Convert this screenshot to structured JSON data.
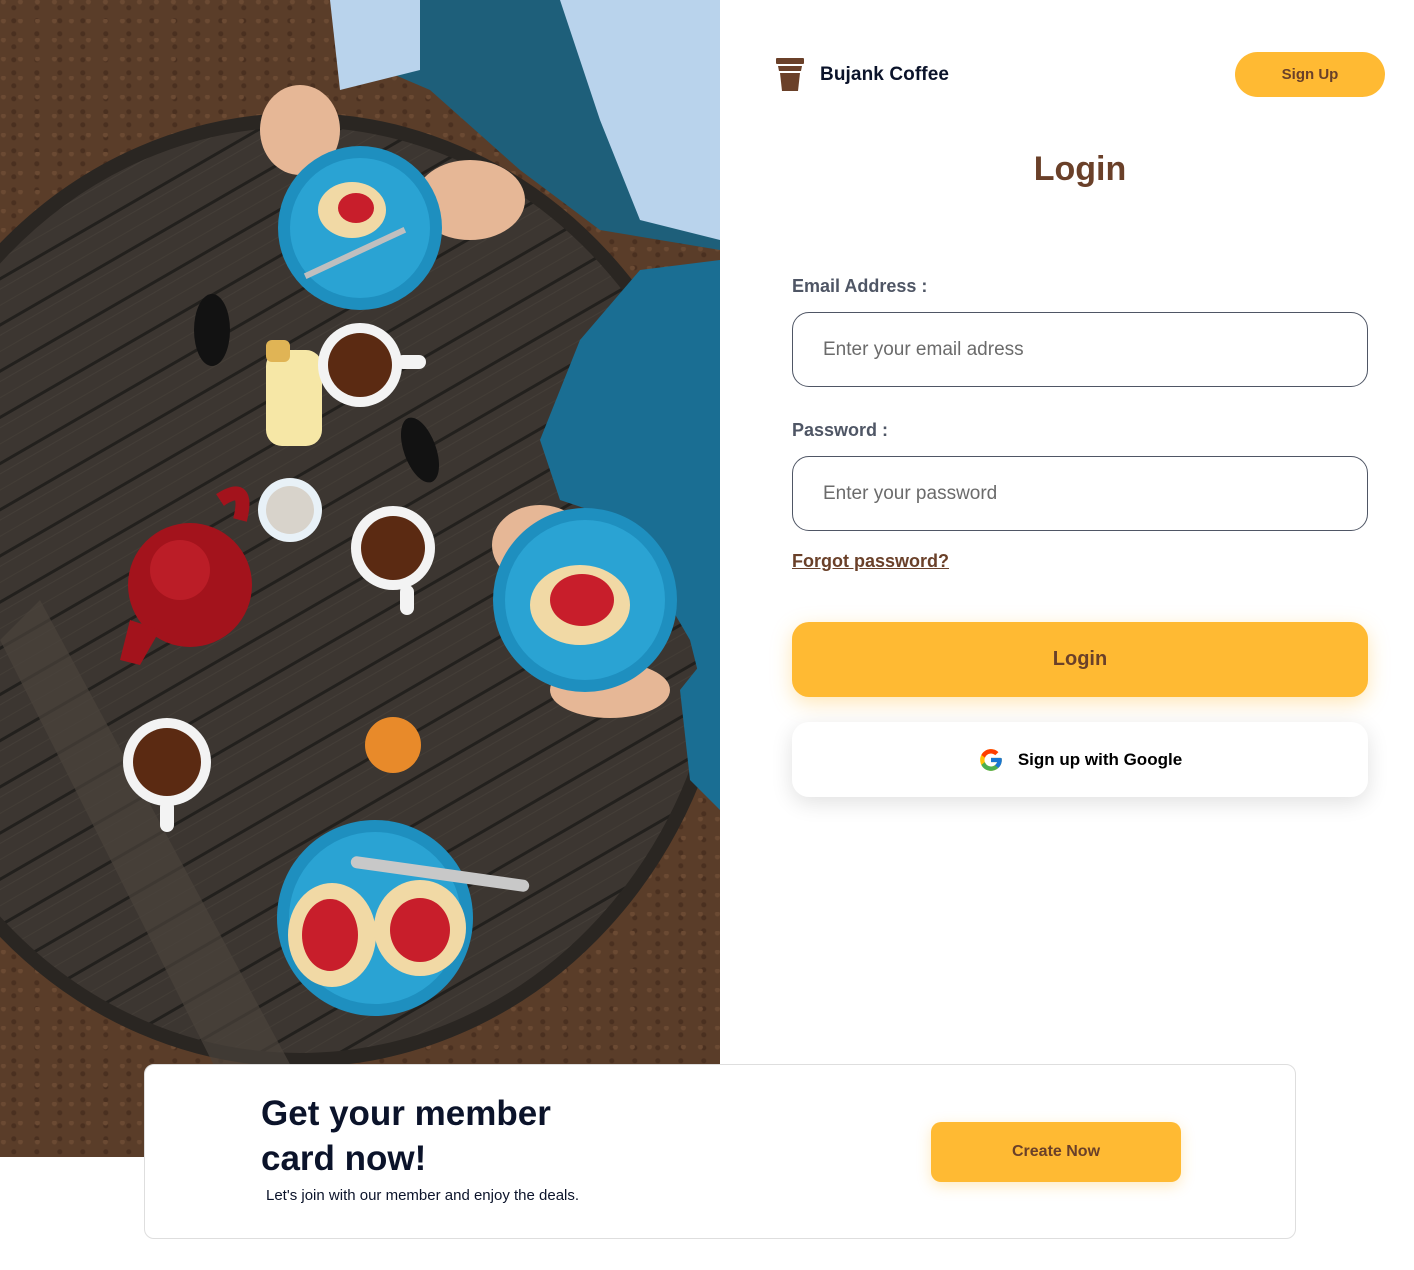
{
  "header": {
    "brand_name": "Bujank Coffee",
    "brand_icon": "coffee-cup-icon",
    "signup_label": "Sign Up"
  },
  "login_form": {
    "title": "Login",
    "email_label": "Email Address :",
    "email_placeholder": "Enter your email adress",
    "email_value": "",
    "password_label": "Password :",
    "password_placeholder": "Enter your password",
    "password_value": "",
    "forgot_label": "Forgot password?",
    "login_label": "Login",
    "google_label": "Sign up with Google",
    "google_icon": "google-g-icon"
  },
  "member_card": {
    "title": "Get your member card now!",
    "subtitle": "Let's join with our member and enjoy the deals.",
    "button_label": "Create Now"
  },
  "colors": {
    "accent": "#ffba33",
    "brown": "#6a4029",
    "navy": "#0b132a",
    "gray_label": "#4f5665"
  },
  "hero_image": {
    "description_icon": "cafe-table-photo"
  }
}
